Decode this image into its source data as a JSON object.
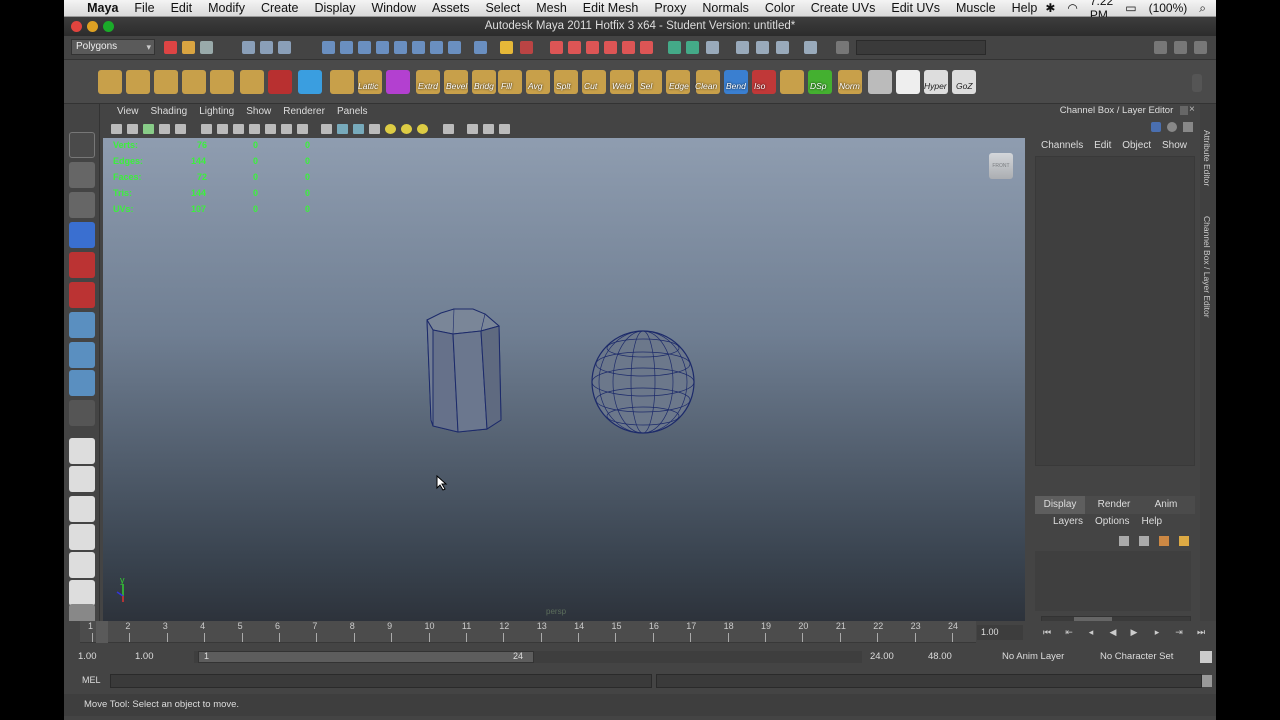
{
  "menubar": {
    "app": "Maya",
    "items": [
      "File",
      "Edit",
      "Modify",
      "Create",
      "Display",
      "Window",
      "Assets",
      "Select",
      "Mesh",
      "Edit Mesh",
      "Proxy",
      "Normals",
      "Color",
      "Create UVs",
      "Edit UVs",
      "Muscle",
      "Help"
    ],
    "clock": "7:22 PM",
    "battery": "(100%)"
  },
  "window": {
    "title": "Autodesk Maya 2011 Hotfix 3 x64 - Student Version: untitled*",
    "menu_set": "Polygons"
  },
  "shelf": {
    "labels": [
      "Lattic",
      "Extrd",
      "Bevel",
      "Bridg",
      "Fill",
      "Avg",
      "Splt",
      "Cut",
      "Weld",
      "Sel",
      "Edge",
      "Clean",
      "Bend",
      "Iso",
      "DSp",
      "Norm",
      "Hyper",
      "GoZ"
    ]
  },
  "viewport": {
    "menu": [
      "View",
      "Shading",
      "Lighting",
      "Show",
      "Renderer",
      "Panels"
    ],
    "hud": [
      {
        "label": "Verts:",
        "v1": "76",
        "v2": "0",
        "v3": "0"
      },
      {
        "label": "Edges:",
        "v1": "144",
        "v2": "0",
        "v3": "0"
      },
      {
        "label": "Faces:",
        "v1": "72",
        "v2": "0",
        "v3": "0"
      },
      {
        "label": "Tris:",
        "v1": "144",
        "v2": "0",
        "v3": "0"
      },
      {
        "label": "UVs:",
        "v1": "107",
        "v2": "0",
        "v3": "0"
      }
    ],
    "camera": "persp",
    "viewcube": "FRONT",
    "axis_y": "y"
  },
  "channel_box": {
    "title": "Channel Box / Layer Editor",
    "menu": [
      "Channels",
      "Edit",
      "Object",
      "Show"
    ],
    "layer_tabs": [
      "Display",
      "Render",
      "Anim"
    ],
    "layer_menu": [
      "Layers",
      "Options",
      "Help"
    ],
    "side_tabs": [
      "Attribute Editor",
      "Channel Box / Layer Editor"
    ]
  },
  "time_slider": {
    "ticks": [
      "1",
      "2",
      "3",
      "4",
      "5",
      "6",
      "7",
      "8",
      "9",
      "10",
      "11",
      "12",
      "13",
      "14",
      "15",
      "16",
      "17",
      "18",
      "19",
      "20",
      "21",
      "22",
      "23",
      "24"
    ],
    "current_frame": "1.00"
  },
  "range_slider": {
    "start": "1.00",
    "playback_start": "1.00",
    "range_start": "1",
    "range_end": "24",
    "playback_end": "24.00",
    "end": "48.00",
    "anim_layer": "No Anim Layer",
    "character_set": "No Character Set"
  },
  "command_line": {
    "label": "MEL"
  },
  "help_line": {
    "text": "Move Tool: Select an object to move."
  }
}
